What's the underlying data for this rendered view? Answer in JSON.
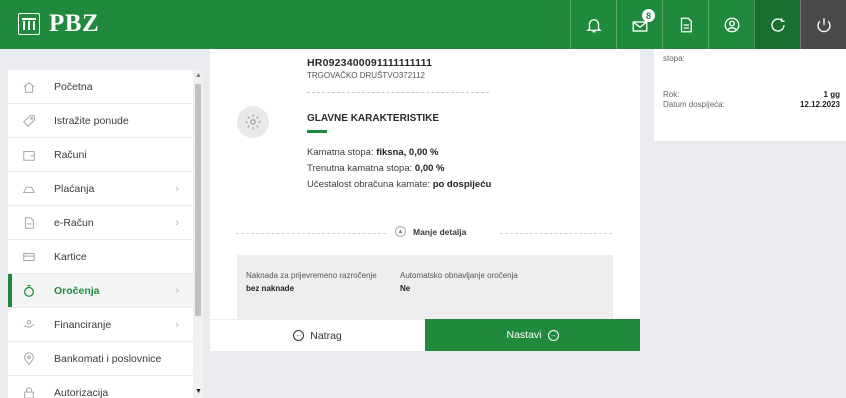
{
  "brand": {
    "name": "PBZ"
  },
  "topbar": {
    "icons": [
      "bell-icon",
      "mail-icon",
      "document-icon",
      "profile-icon",
      "refresh-icon",
      "power-icon"
    ],
    "mail_badge": "8",
    "accent": "#1f8a3c"
  },
  "sidebar": {
    "items": [
      {
        "label": "Početna",
        "icon": "home-icon",
        "chevron": false,
        "active": false
      },
      {
        "label": "Istražite ponude",
        "icon": "tag-icon",
        "chevron": false,
        "active": false
      },
      {
        "label": "Računi",
        "icon": "wallet-icon",
        "chevron": false,
        "active": false
      },
      {
        "label": "Plaćanja",
        "icon": "payments-icon",
        "chevron": true,
        "active": false
      },
      {
        "label": "e-Račun",
        "icon": "e-invoice-icon",
        "chevron": true,
        "active": false
      },
      {
        "label": "Kartice",
        "icon": "card-icon",
        "chevron": false,
        "active": false
      },
      {
        "label": "Oročenja",
        "icon": "deposit-icon",
        "chevron": true,
        "active": true
      },
      {
        "label": "Financiranje",
        "icon": "financing-icon",
        "chevron": true,
        "active": false
      },
      {
        "label": "Bankomati i poslovnice",
        "icon": "location-icon",
        "chevron": false,
        "active": false
      },
      {
        "label": "Autorizacija",
        "icon": "lock-icon",
        "chevron": false,
        "active": false
      }
    ]
  },
  "main": {
    "account_number": "HR0923400091111111111",
    "account_name": "TRGOVAČKO DRUŠTVO372112",
    "section_title": "GLAVNE KARAKTERISTIKE",
    "rate_label": "Kamatna stopa:",
    "rate_value": "fiksna, 0,00 %",
    "current_rate_label": "Trenutna kamatna stopa:",
    "current_rate_value": "0,00 %",
    "frequency_label": "Učestalost obračuna kamate:",
    "frequency_value": "po dospijeću",
    "details_toggle": "Manje detalja",
    "details": [
      {
        "label": "Naknada za prijevremeno razročenje",
        "value": "bez naknade"
      },
      {
        "label": "Automatsko obnavljanje oročenja",
        "value": "Ne"
      }
    ]
  },
  "buttons": {
    "back": "Natrag",
    "next": "Nastavi"
  },
  "right_panel": {
    "top_label": "stopa:",
    "rows": [
      {
        "label": "Rok:",
        "value": "1 gg"
      },
      {
        "label": "Datum dospijeća:",
        "value": "12.12.2023"
      }
    ]
  }
}
